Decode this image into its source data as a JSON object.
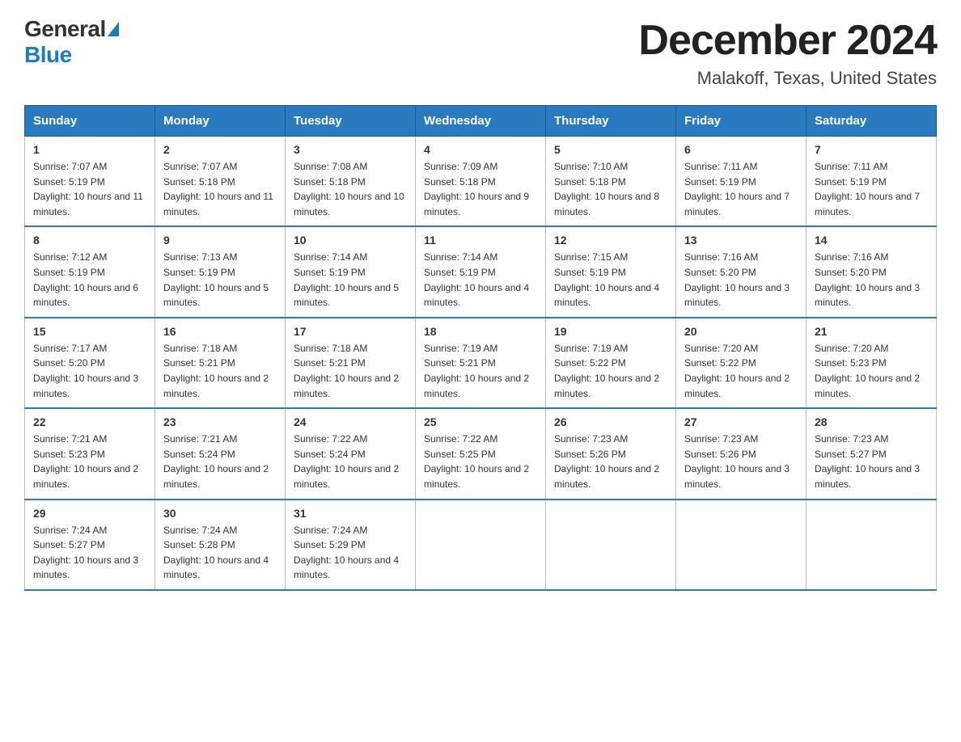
{
  "logo": {
    "general_text": "General",
    "blue_text": "Blue"
  },
  "title": {
    "month_year": "December 2024",
    "location": "Malakoff, Texas, United States"
  },
  "headers": [
    "Sunday",
    "Monday",
    "Tuesday",
    "Wednesday",
    "Thursday",
    "Friday",
    "Saturday"
  ],
  "weeks": [
    [
      {
        "day": "1",
        "sunrise": "7:07 AM",
        "sunset": "5:19 PM",
        "daylight": "10 hours and 11 minutes."
      },
      {
        "day": "2",
        "sunrise": "7:07 AM",
        "sunset": "5:18 PM",
        "daylight": "10 hours and 11 minutes."
      },
      {
        "day": "3",
        "sunrise": "7:08 AM",
        "sunset": "5:18 PM",
        "daylight": "10 hours and 10 minutes."
      },
      {
        "day": "4",
        "sunrise": "7:09 AM",
        "sunset": "5:18 PM",
        "daylight": "10 hours and 9 minutes."
      },
      {
        "day": "5",
        "sunrise": "7:10 AM",
        "sunset": "5:18 PM",
        "daylight": "10 hours and 8 minutes."
      },
      {
        "day": "6",
        "sunrise": "7:11 AM",
        "sunset": "5:19 PM",
        "daylight": "10 hours and 7 minutes."
      },
      {
        "day": "7",
        "sunrise": "7:11 AM",
        "sunset": "5:19 PM",
        "daylight": "10 hours and 7 minutes."
      }
    ],
    [
      {
        "day": "8",
        "sunrise": "7:12 AM",
        "sunset": "5:19 PM",
        "daylight": "10 hours and 6 minutes."
      },
      {
        "day": "9",
        "sunrise": "7:13 AM",
        "sunset": "5:19 PM",
        "daylight": "10 hours and 5 minutes."
      },
      {
        "day": "10",
        "sunrise": "7:14 AM",
        "sunset": "5:19 PM",
        "daylight": "10 hours and 5 minutes."
      },
      {
        "day": "11",
        "sunrise": "7:14 AM",
        "sunset": "5:19 PM",
        "daylight": "10 hours and 4 minutes."
      },
      {
        "day": "12",
        "sunrise": "7:15 AM",
        "sunset": "5:19 PM",
        "daylight": "10 hours and 4 minutes."
      },
      {
        "day": "13",
        "sunrise": "7:16 AM",
        "sunset": "5:20 PM",
        "daylight": "10 hours and 3 minutes."
      },
      {
        "day": "14",
        "sunrise": "7:16 AM",
        "sunset": "5:20 PM",
        "daylight": "10 hours and 3 minutes."
      }
    ],
    [
      {
        "day": "15",
        "sunrise": "7:17 AM",
        "sunset": "5:20 PM",
        "daylight": "10 hours and 3 minutes."
      },
      {
        "day": "16",
        "sunrise": "7:18 AM",
        "sunset": "5:21 PM",
        "daylight": "10 hours and 2 minutes."
      },
      {
        "day": "17",
        "sunrise": "7:18 AM",
        "sunset": "5:21 PM",
        "daylight": "10 hours and 2 minutes."
      },
      {
        "day": "18",
        "sunrise": "7:19 AM",
        "sunset": "5:21 PM",
        "daylight": "10 hours and 2 minutes."
      },
      {
        "day": "19",
        "sunrise": "7:19 AM",
        "sunset": "5:22 PM",
        "daylight": "10 hours and 2 minutes."
      },
      {
        "day": "20",
        "sunrise": "7:20 AM",
        "sunset": "5:22 PM",
        "daylight": "10 hours and 2 minutes."
      },
      {
        "day": "21",
        "sunrise": "7:20 AM",
        "sunset": "5:23 PM",
        "daylight": "10 hours and 2 minutes."
      }
    ],
    [
      {
        "day": "22",
        "sunrise": "7:21 AM",
        "sunset": "5:23 PM",
        "daylight": "10 hours and 2 minutes."
      },
      {
        "day": "23",
        "sunrise": "7:21 AM",
        "sunset": "5:24 PM",
        "daylight": "10 hours and 2 minutes."
      },
      {
        "day": "24",
        "sunrise": "7:22 AM",
        "sunset": "5:24 PM",
        "daylight": "10 hours and 2 minutes."
      },
      {
        "day": "25",
        "sunrise": "7:22 AM",
        "sunset": "5:25 PM",
        "daylight": "10 hours and 2 minutes."
      },
      {
        "day": "26",
        "sunrise": "7:23 AM",
        "sunset": "5:26 PM",
        "daylight": "10 hours and 2 minutes."
      },
      {
        "day": "27",
        "sunrise": "7:23 AM",
        "sunset": "5:26 PM",
        "daylight": "10 hours and 3 minutes."
      },
      {
        "day": "28",
        "sunrise": "7:23 AM",
        "sunset": "5:27 PM",
        "daylight": "10 hours and 3 minutes."
      }
    ],
    [
      {
        "day": "29",
        "sunrise": "7:24 AM",
        "sunset": "5:27 PM",
        "daylight": "10 hours and 3 minutes."
      },
      {
        "day": "30",
        "sunrise": "7:24 AM",
        "sunset": "5:28 PM",
        "daylight": "10 hours and 4 minutes."
      },
      {
        "day": "31",
        "sunrise": "7:24 AM",
        "sunset": "5:29 PM",
        "daylight": "10 hours and 4 minutes."
      },
      null,
      null,
      null,
      null
    ]
  ],
  "labels": {
    "sunrise": "Sunrise:",
    "sunset": "Sunset:",
    "daylight": "Daylight:"
  }
}
